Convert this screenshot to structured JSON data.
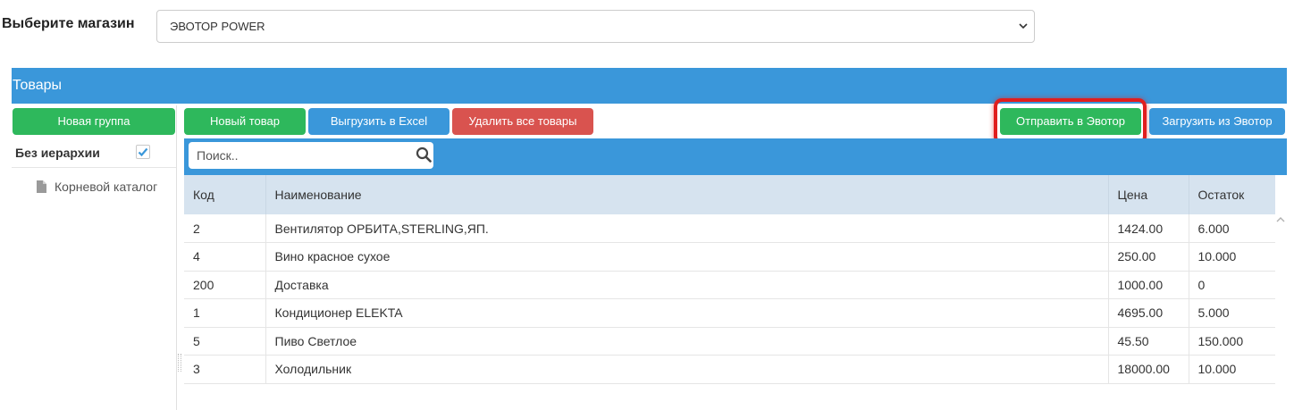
{
  "store": {
    "label": "Выберите магазин",
    "selected": "ЭВОТОР POWER"
  },
  "panel": {
    "title": "Товары"
  },
  "sidebar": {
    "new_group_label": "Новая группа",
    "no_hierarchy_label": "Без иерархии",
    "no_hierarchy_checked": true,
    "tree": [
      {
        "label": "Корневой каталог"
      }
    ]
  },
  "toolbar": {
    "new_item_label": "Новый товар",
    "export_excel_label": "Выгрузить в Excel",
    "delete_all_label": "Удалить все товары",
    "send_to_evotor_label": "Отправить в Эвотор",
    "load_from_evotor_label": "Загрузить из Эвотор"
  },
  "search": {
    "placeholder": "Поиск.."
  },
  "table": {
    "columns": [
      "Код",
      "Наименование",
      "Цена",
      "Остаток"
    ],
    "rows": [
      [
        "2",
        "Вентилятор ОРБИТА,STERLING,ЯП.",
        "1424.00",
        "6.000"
      ],
      [
        "4",
        "Вино красное сухое",
        "250.00",
        "10.000"
      ],
      [
        "200",
        "Доставка",
        "1000.00",
        "0"
      ],
      [
        "1",
        "Кондиционер ELEKTA",
        "4695.00",
        "5.000"
      ],
      [
        "5",
        "Пиво Светлое",
        "45.50",
        "150.000"
      ],
      [
        "3",
        "Холодильник",
        "18000.00",
        "10.000"
      ]
    ]
  },
  "colors": {
    "primary_blue": "#3a97da",
    "success_green": "#2eb85c",
    "danger_red": "#d9534f",
    "highlight_red": "#e01e1e",
    "table_header_bg": "#d6e3ef"
  }
}
